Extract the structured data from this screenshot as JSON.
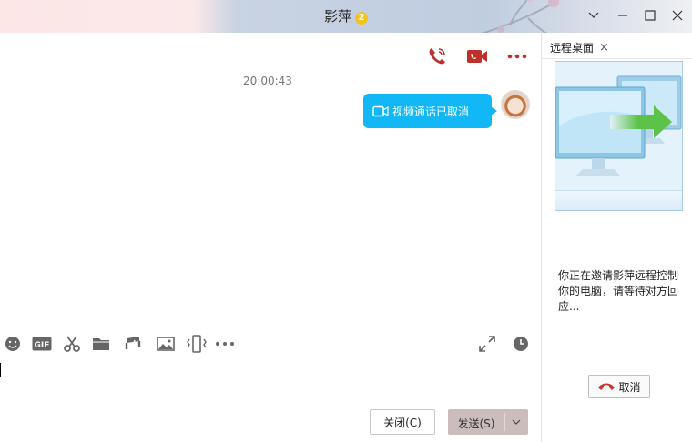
{
  "window": {
    "title": "影萍",
    "badge": "2"
  },
  "chat": {
    "timestamp": "20:00:43",
    "message": "视频通话已取消"
  },
  "footer": {
    "close_label": "关闭(C)",
    "send_label": "发送(S)"
  },
  "remote_panel": {
    "tab_label": "远程桌面",
    "close_glyph": "×",
    "status_text": "你正在邀请影萍远程控制你的电脑，请等待对方回应...",
    "cancel_label": "取消"
  },
  "colors": {
    "accent_red": "#c0302b",
    "bubble_blue": "#12b7f5",
    "send_button": "#ccbdbd"
  },
  "icons": {
    "toolbar": [
      "emoji-icon",
      "gif-icon",
      "screenshot-icon",
      "folder-icon",
      "music-icon",
      "image-icon",
      "shake-icon",
      "more-icon"
    ]
  }
}
